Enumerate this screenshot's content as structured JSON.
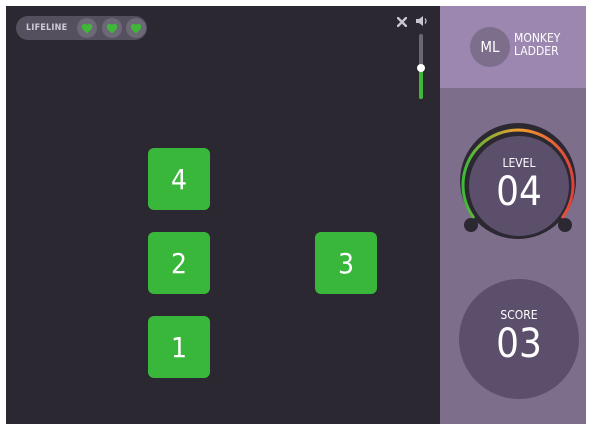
{
  "hud": {
    "lifeline_label": "LIFELINE",
    "lives": 3,
    "volume_level": 0.48
  },
  "tiles": [
    {
      "label": "4"
    },
    {
      "label": "2"
    },
    {
      "label": "3"
    },
    {
      "label": "1"
    }
  ],
  "panel": {
    "brand_initials": "ML",
    "brand_name": "MONKEY LADDER",
    "level_label": "LEVEL",
    "level_value": "04",
    "score_label": "SCORE",
    "score_value": "03"
  },
  "colors": {
    "board_background": "#2b2832",
    "tile": "#38b73a",
    "heart": "#3fb83a",
    "panel": "#7d6e8c",
    "panel_header": "#9c87b0",
    "circle": "#5c4f6b",
    "gauge_start": "#3fb83a",
    "gauge_mid": "#f0a030",
    "gauge_end": "#e0403a"
  },
  "icons": {
    "heart": "heart-icon",
    "close": "close-icon",
    "volume": "speaker-icon"
  }
}
